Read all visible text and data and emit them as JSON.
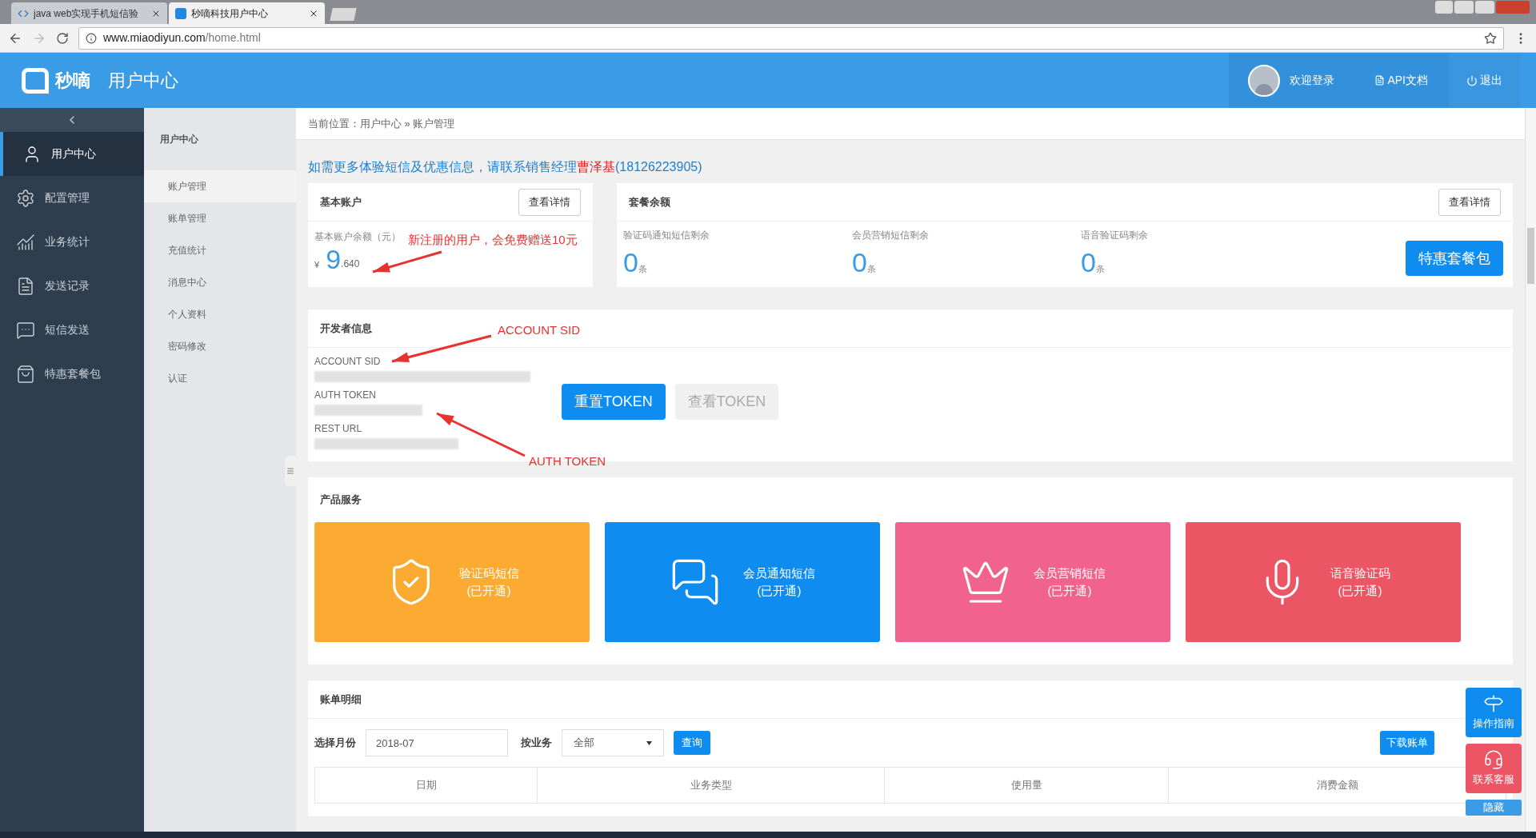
{
  "browser": {
    "tabs": [
      {
        "title": "java web实现手机短信验",
        "selected": false,
        "kind": "code"
      },
      {
        "title": "秒嘀科技用户中心",
        "selected": true,
        "kind": "brand"
      }
    ],
    "url": {
      "host": "www.miaodiyun.com",
      "path": "/home.html"
    }
  },
  "header": {
    "brand": "秒嘀",
    "title": "用户中心",
    "user": "欢迎登录",
    "api": "API文档",
    "logout": "退出"
  },
  "sidebar": {
    "items": [
      {
        "label": "用户中心",
        "kind": "user",
        "selected": true
      },
      {
        "label": "配置管理",
        "kind": "gear",
        "selected": false
      },
      {
        "label": "业务统计",
        "kind": "chart",
        "selected": false
      },
      {
        "label": "发送记录",
        "kind": "file",
        "selected": false
      },
      {
        "label": "短信发送",
        "kind": "message",
        "selected": false
      },
      {
        "label": "特惠套餐包",
        "kind": "bag",
        "selected": false
      }
    ]
  },
  "subnav": {
    "title": "用户中心",
    "items": [
      {
        "label": "账户管理",
        "selected": true
      },
      {
        "label": "账单管理",
        "selected": false
      },
      {
        "label": "充值统计",
        "selected": false
      },
      {
        "label": "消息中心",
        "selected": false
      },
      {
        "label": "个人资料",
        "selected": false
      },
      {
        "label": "密码修改",
        "selected": false
      },
      {
        "label": "认证",
        "selected": false
      }
    ]
  },
  "breadcrumb": "当前位置：用户中心 » 账户管理",
  "notice": {
    "text": "如需更多体验短信及优惠信息，请联系销售经理",
    "name": "曹泽基",
    "phone": "(18126223905)"
  },
  "basic_account": {
    "title": "基本账户",
    "button": "查看详情",
    "label": "基本账户余额（元）",
    "currency": "¥",
    "integer": "9",
    "decimal": ".640"
  },
  "packages": {
    "title": "套餐余额",
    "button": "查看详情",
    "items": [
      {
        "label": "验证码通知短信剩余",
        "count": "0",
        "unit": "条"
      },
      {
        "label": "会员营销短信剩余",
        "count": "0",
        "unit": "条"
      },
      {
        "label": "语音验证码剩余",
        "count": "0",
        "unit": "条"
      }
    ],
    "promo_button": "特惠套餐包"
  },
  "developer": {
    "title": "开发者信息",
    "fields": [
      {
        "label": "ACCOUNT SID"
      },
      {
        "label": "AUTH TOKEN"
      },
      {
        "label": "REST URL"
      }
    ],
    "buttons": [
      {
        "label": "重置TOKEN",
        "disabled": false
      },
      {
        "label": "查看TOKEN",
        "disabled": true
      }
    ]
  },
  "annotations": [
    {
      "text": "新注册的用户，会免费赠送10元"
    },
    {
      "text": "ACCOUNT SID"
    },
    {
      "text": "AUTH TOKEN"
    }
  ],
  "products": {
    "title": "产品服务",
    "tiles": [
      {
        "name": "验证码短信",
        "status": "(已开通)",
        "color": "#fbab32",
        "kind": "shield"
      },
      {
        "name": "会员通知短信",
        "status": "(已开通)",
        "color": "#0e8cf0",
        "kind": "chat"
      },
      {
        "name": "会员营销短信",
        "status": "(已开通)",
        "color": "#f2628e",
        "kind": "crown"
      },
      {
        "name": "语音验证码",
        "status": "(已开通)",
        "color": "#ec5564",
        "kind": "mic"
      }
    ]
  },
  "bill": {
    "title": "账单明细",
    "month_label": "选择月份",
    "month": "2018-07",
    "business_label": "按业务",
    "business": "全部",
    "query": "查询",
    "download": "下载账单",
    "columns": [
      "日期",
      "业务类型",
      "使用量",
      "消费金额"
    ]
  },
  "float": {
    "items": [
      {
        "label": "操作指南",
        "color": "#0e8cf0",
        "kind": "signpost"
      },
      {
        "label": "联系客服",
        "color": "#ec5564",
        "kind": "headset"
      }
    ],
    "hide": "隐藏"
  }
}
